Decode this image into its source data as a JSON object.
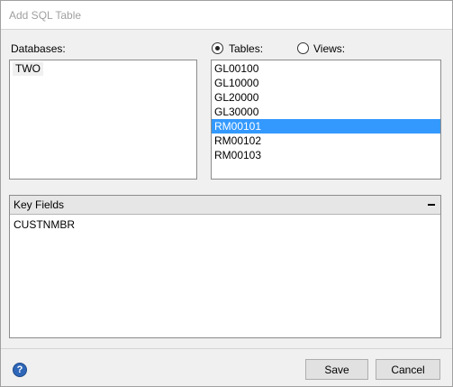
{
  "window": {
    "title": "Add SQL Table"
  },
  "databases": {
    "label": "Databases:",
    "items": [
      "TWO"
    ]
  },
  "source": {
    "tables_label": "Tables:",
    "views_label": "Views:",
    "selected": "tables"
  },
  "tables": {
    "items": [
      "GL00100",
      "GL10000",
      "GL20000",
      "GL30000",
      "RM00101",
      "RM00102",
      "RM00103"
    ],
    "selected_index": 4
  },
  "key_fields": {
    "title": "Key Fields",
    "items": [
      "CUSTNMBR"
    ]
  },
  "buttons": {
    "save": "Save",
    "cancel": "Cancel"
  },
  "icons": {
    "help": "help-icon",
    "collapse": "collapse-icon"
  },
  "colors": {
    "selection": "#3399ff",
    "help": "#2f67b8"
  }
}
